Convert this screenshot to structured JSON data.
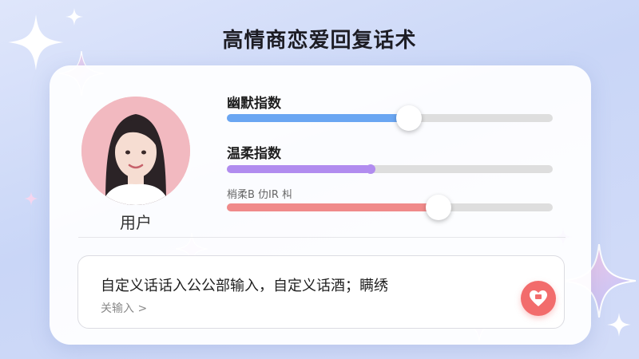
{
  "header": {
    "title": "高情商恋爱回复话术"
  },
  "profile": {
    "label": "用户"
  },
  "sliders": [
    {
      "label": "幽默指数",
      "level": 0.56,
      "color": "#6aa6f2"
    },
    {
      "label": "温柔指数",
      "level": 0.44,
      "color": "#b18cef"
    },
    {
      "label": "梢柔B 仂IR 朻",
      "level": 0.65,
      "color": "#f08a8a"
    }
  ],
  "input": {
    "main_text": "自定义话话入公公部输入，自定义话酒；瞒绣",
    "sub_text": "关输入 >"
  },
  "icons": {
    "title_icon": "sparkle-icon",
    "send": "heart-chat-icon"
  },
  "colors": {
    "accent_blue": "#6aa6f2",
    "accent_purple": "#b18cef",
    "accent_red": "#f26c6c"
  }
}
